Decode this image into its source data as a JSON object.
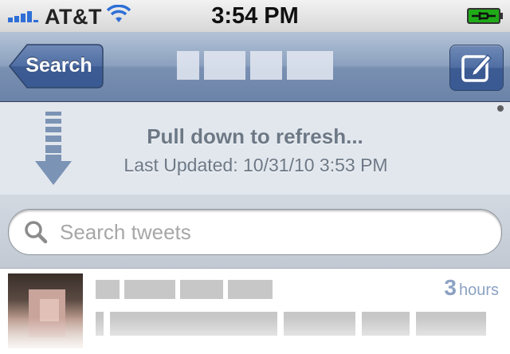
{
  "status_bar": {
    "carrier": "AT&T",
    "time": "3:54 PM",
    "signal_bars": 4,
    "battery_state": "charging",
    "colors": {
      "signal": "#2f6fd6",
      "wifi": "#2f6fd6",
      "battery": "#1faa18"
    }
  },
  "nav": {
    "back_label": "Search",
    "compose_icon": "compose-icon",
    "colors": {
      "bar": "#7990b2",
      "button": "#4f6ea3"
    }
  },
  "pull_to_refresh": {
    "title": "Pull down to refresh...",
    "last_updated": "Last Updated: 10/31/10 3:53 PM",
    "arrow_icon": "down-arrow-icon"
  },
  "search": {
    "placeholder": "Search tweets",
    "value": "",
    "icon": "search-icon"
  },
  "tweets": [
    {
      "time_value": "3",
      "time_unit": "hours"
    }
  ]
}
